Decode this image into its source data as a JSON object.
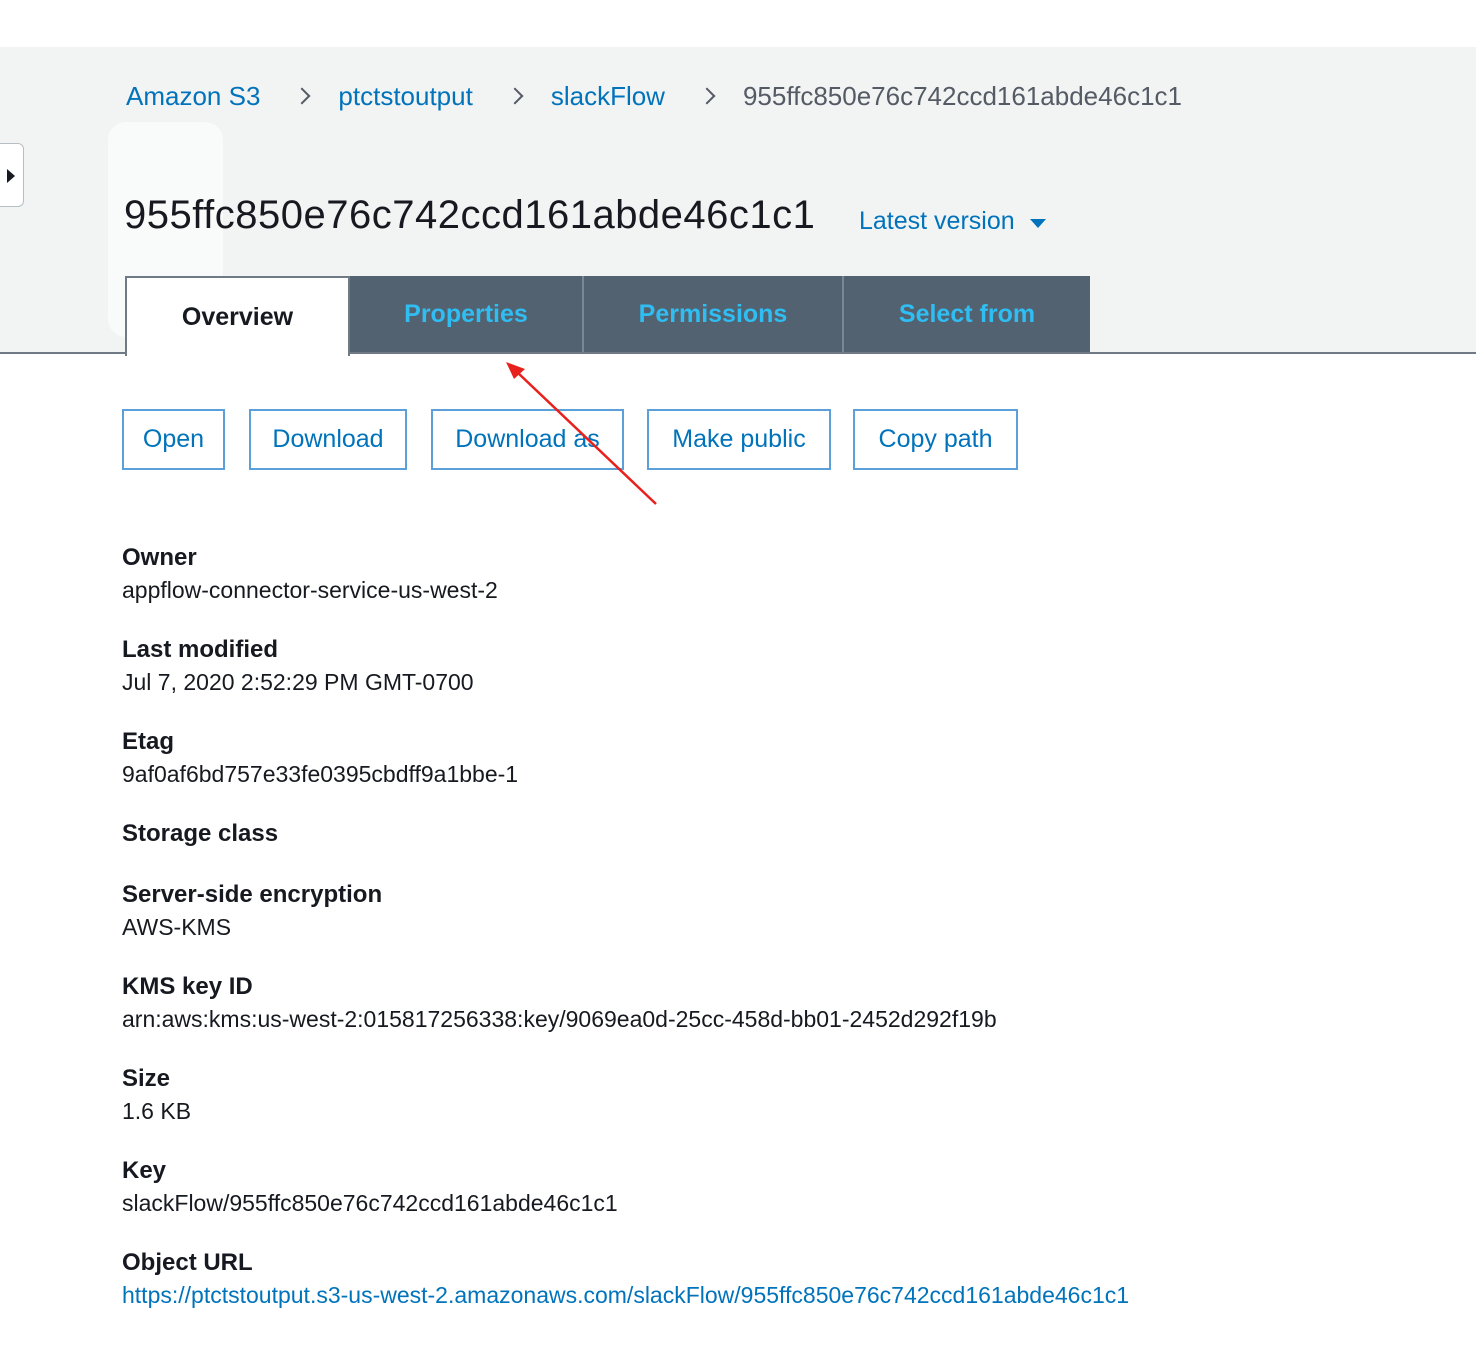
{
  "breadcrumb": {
    "items": [
      {
        "label": "Amazon S3"
      },
      {
        "label": "ptctstoutput"
      },
      {
        "label": "slackFlow"
      }
    ],
    "current": "955ffc850e76c742ccd161abde46c1c1"
  },
  "header": {
    "title": "955ffc850e76c742ccd161abde46c1c1",
    "version_label": "Latest version"
  },
  "tabs": [
    {
      "label": "Overview",
      "active": true
    },
    {
      "label": "Properties",
      "active": false
    },
    {
      "label": "Permissions",
      "active": false
    },
    {
      "label": "Select from",
      "active": false
    }
  ],
  "actions": {
    "open": "Open",
    "download": "Download",
    "download_as": "Download as",
    "make_public": "Make public",
    "copy_path": "Copy path"
  },
  "details": {
    "owner": {
      "label": "Owner",
      "value": "appflow-connector-service-us-west-2"
    },
    "last_modified": {
      "label": "Last modified",
      "value": "Jul 7, 2020 2:52:29 PM GMT-0700"
    },
    "etag": {
      "label": "Etag",
      "value": "9af0af6bd757e33fe0395cbdff9a1bbe-1"
    },
    "storage_class": {
      "label": "Storage class",
      "value": ""
    },
    "encryption": {
      "label": "Server-side encryption",
      "value": "AWS-KMS"
    },
    "kms_key_id": {
      "label": "KMS key ID",
      "value": "arn:aws:kms:us-west-2:015817256338:key/9069ea0d-25cc-458d-bb01-2452d292f19b"
    },
    "size": {
      "label": "Size",
      "value": "1.6 KB"
    },
    "key": {
      "label": "Key",
      "value": "slackFlow/955ffc850e76c742ccd161abde46c1c1"
    },
    "object_url": {
      "label": "Object URL",
      "value": "https://ptctstoutput.s3-us-west-2.amazonaws.com/slackFlow/955ffc850e76c742ccd161abde46c1c1"
    }
  },
  "colors": {
    "link": "#0073bb",
    "tab_inactive_bg": "#536270",
    "tab_inactive_text": "#2fbdf2",
    "annotation_arrow": "#e8211d"
  },
  "icons": {
    "collapse": "caret-right-icon",
    "breadcrumb_separator": "chevron-right-icon",
    "version_dropdown": "caret-down-icon"
  }
}
